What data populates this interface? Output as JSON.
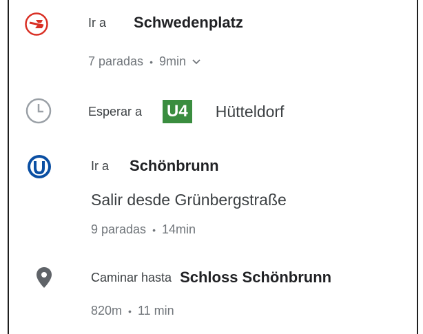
{
  "steps": [
    {
      "icon": "tram-icon",
      "action": "Ir a",
      "destination": "Schwedenplatz",
      "stops": "7 paradas",
      "duration": "9min"
    },
    {
      "icon": "clock-icon",
      "action": "Esperar a",
      "line": "U4",
      "line_color": "#3a8d3f",
      "direction": "Hütteldorf"
    },
    {
      "icon": "u-bahn-icon",
      "action": "Ir a",
      "destination": "Schönbrunn",
      "exit": "Salir desde Grünbergstraße",
      "stops": "9 paradas",
      "duration": "14min"
    },
    {
      "icon": "location-pin-icon",
      "action": "Caminar hasta",
      "destination": "Schloss Schönbrunn",
      "distance": "820m",
      "duration": "11 min"
    }
  ],
  "colors": {
    "tram_red": "#d93025",
    "ubahn_blue": "#0a4fa3",
    "grey": "#5f6368"
  }
}
